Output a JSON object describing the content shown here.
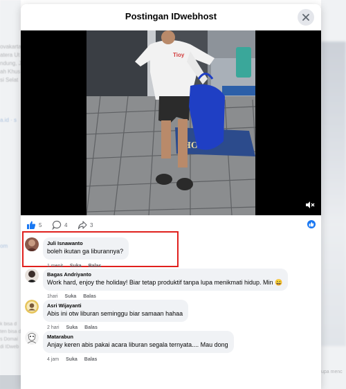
{
  "modal": {
    "title": "Postingan IDwebhost"
  },
  "background": {
    "left_lines": [
      "ovakarta,",
      "atera Ut",
      "ndung, J",
      "ah Khus",
      "si Selat"
    ],
    "left_link": "a.id · s",
    "left_link2": "om",
    "left_lines2": [
      "k bisa d",
      "ten bisa d",
      "s Domai",
      "di IDweb"
    ],
    "right_text": "upa menc"
  },
  "reactions": {
    "likes": "5",
    "comments": "4",
    "shares": "3"
  },
  "comments": [
    {
      "name": "Juli Isnawanto",
      "text": "boleh ikutan ga liburannya?",
      "time": "1 menit",
      "like": "Suka",
      "reply": "Balas"
    },
    {
      "name": "Bagas Andriyanto",
      "text": "Work hard, enjoy the holiday! Biar tetap produktif tanpa lupa menikmati hidup. Min 😄",
      "time": "1hari",
      "like": "Suka",
      "reply": "Balas"
    },
    {
      "name": "Asri Wijayanti",
      "text": "Abis ini otw liburan seminggu biar samaan hahaa",
      "time": "2 hari",
      "like": "Suka",
      "reply": "Balas"
    },
    {
      "name": "Matarabun",
      "text": "Anjay keren abis pakai acara liburan segala ternyata.... Mau dong",
      "time": "4 jam",
      "like": "Suka",
      "reply": "Balas"
    }
  ],
  "colors": {
    "accent": "#1877f2",
    "highlight": "#e0201d",
    "bubble": "#f0f2f5"
  }
}
